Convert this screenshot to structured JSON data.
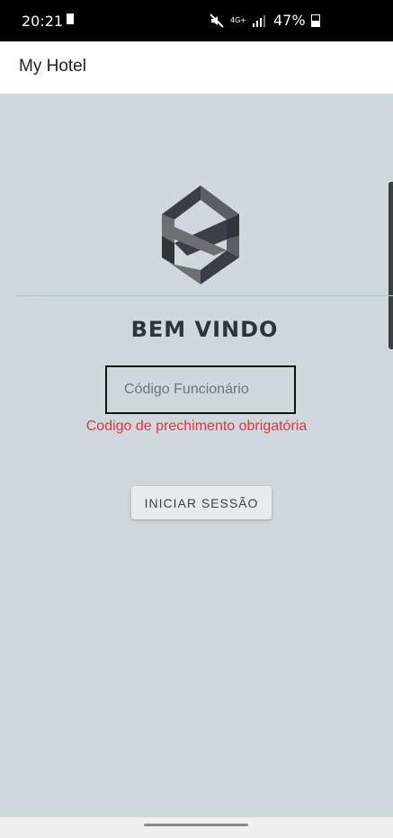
{
  "status_bar": {
    "time": "20:21",
    "network": "4G+",
    "battery": "47%",
    "icons": [
      "sim-card-icon",
      "mute-icon",
      "signal-icon",
      "battery-icon"
    ]
  },
  "app_bar": {
    "title": "My Hotel"
  },
  "login": {
    "welcome": "BEM VINDO",
    "code_placeholder": "Código Funcionário",
    "code_value": "",
    "error": "Codigo de prechimento obrigatória",
    "submit_label": "INICIAR SESSÃO",
    "logo": "hotel-logo-icon"
  },
  "colors": {
    "background": "#cfd9dd",
    "error": "#e0353f",
    "logo_dark": "#3a3f45",
    "logo_light": "#6c7075"
  }
}
